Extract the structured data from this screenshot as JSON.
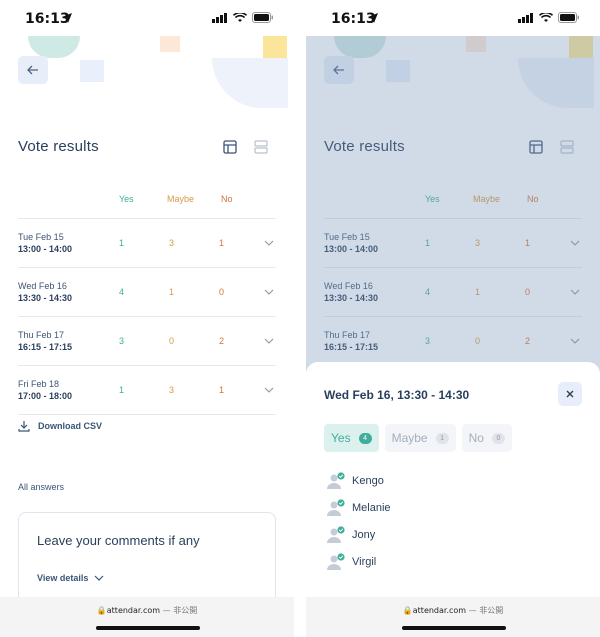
{
  "status_bar": {
    "time": "16:13"
  },
  "url_bar": {
    "domain": "attendar.com",
    "suffix": "— 非公開"
  },
  "page": {
    "title": "Vote results",
    "columns": {
      "yes": "Yes",
      "maybe": "Maybe",
      "no": "No"
    },
    "rows": [
      {
        "date": "Tue Feb 15",
        "time": "13:00 - 14:00",
        "yes": "1",
        "maybe": "3",
        "no": "1"
      },
      {
        "date": "Wed Feb 16",
        "time": "13:30 - 14:30",
        "yes": "4",
        "maybe": "1",
        "no": "0"
      },
      {
        "date": "Thu Feb 17",
        "time": "16:15 - 17:15",
        "yes": "3",
        "maybe": "0",
        "no": "2"
      },
      {
        "date": "Fri Feb 18",
        "time": "17:00 - 18:00",
        "yes": "1",
        "maybe": "3",
        "no": "1"
      }
    ],
    "download_label": "Download CSV",
    "all_answers_label": "All answers",
    "comments_title": "Leave your comments if any",
    "view_details_label": "View details"
  },
  "sheet": {
    "title": "Wed Feb 16, 13:30 - 14:30",
    "tabs": [
      {
        "label": "Yes",
        "count": "4"
      },
      {
        "label": "Maybe",
        "count": "1"
      },
      {
        "label": "No",
        "count": "0"
      }
    ],
    "voters": [
      "Kengo",
      "Melanie",
      "Jony",
      "Virgil"
    ]
  },
  "colors": {
    "yes": "#3eae9a",
    "maybe": "#d59a44",
    "no": "#d2743c",
    "title": "#2a3f5c"
  }
}
